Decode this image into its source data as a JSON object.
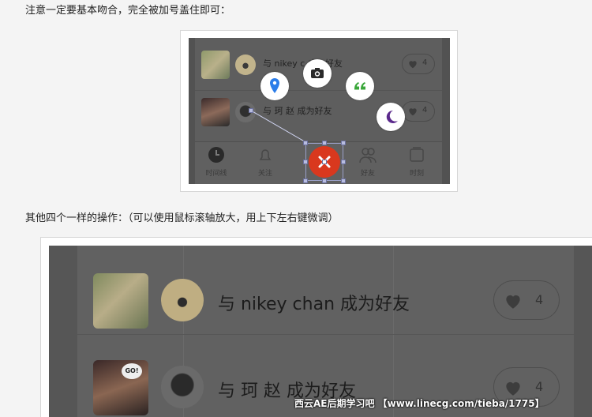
{
  "instructions": {
    "line1": "注意一定要基本吻合，完全被加号盖住即可：",
    "line2": "其他四个一样的操作：（可以使用鼠标滚轴放大，用上下左右键微调）"
  },
  "preview_small": {
    "rows": [
      {
        "text": "与 nikey c   成为好友",
        "count": "4"
      },
      {
        "text": "与 珂 赵 成为好友",
        "count": "4"
      }
    ],
    "tabs": [
      "时间线",
      "关注",
      "",
      "好友",
      "时刻"
    ],
    "bubble_icons": [
      "location-pin-icon",
      "camera-icon",
      "quote-icon",
      "moon-icon"
    ],
    "colors": {
      "fab": "#d9381e",
      "location": "#2b7de9",
      "quote": "#3aa73a",
      "moon": "#5b2a8c"
    }
  },
  "preview_large": {
    "rows": [
      {
        "text": "与 nikey chan 成为好友",
        "count": "4"
      },
      {
        "text": "与 珂 赵 成为好友",
        "count": "4"
      }
    ],
    "badge": "GO!"
  },
  "watermark": "西云AE后期学习吧  【www.linecg.com/tieba/1775】"
}
